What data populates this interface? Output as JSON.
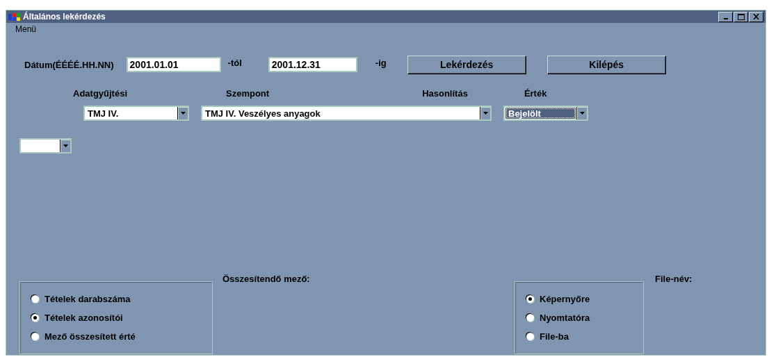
{
  "window": {
    "title": "Általános lekérdezés"
  },
  "menu": [
    "Menü"
  ],
  "date_row": {
    "label": "Dátum(ÉÉÉÉ.HH.NN)",
    "from": "2001.01.01",
    "from_suffix": "-tól",
    "to": "2001.12.31",
    "to_suffix": "-ig"
  },
  "buttons": [
    "Lekérdezés",
    "Kilépés"
  ],
  "headings": [
    "Adatgyűjtési",
    "Szempont",
    "Hasonlítás",
    "Érték"
  ],
  "combos": [
    {
      "value": "TMJ IV.",
      "focused": false
    },
    {
      "value": "TMJ IV. Veszélyes anyagok",
      "focused": false
    },
    {
      "value": "Bejelölt",
      "focused": true
    }
  ],
  "extra_combo": {
    "focused": false
  },
  "summary": {
    "label": "Összesítendő mező:",
    "options": [
      {
        "label": "Tételek darabszáma",
        "selected": false
      },
      {
        "label": "Tételek azonosítói",
        "selected": true
      },
      {
        "label": "Mező összesített érté",
        "selected": false
      }
    ]
  },
  "output": {
    "label": "File-név:",
    "options": [
      {
        "label": "Képernyőre",
        "selected": true
      },
      {
        "label": "Nyomtatóra",
        "selected": false
      },
      {
        "label": "File-ba",
        "selected": false
      }
    ]
  }
}
